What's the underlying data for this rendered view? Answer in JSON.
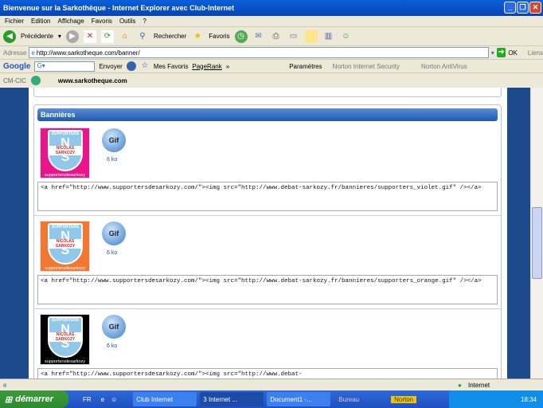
{
  "window": {
    "title": "Bienvenue sur la Sarkothèque - Internet Explorer avec Club-Internet"
  },
  "menu": [
    "Fichier",
    "Edition",
    "Affichage",
    "Favoris",
    "Outils",
    "?"
  ],
  "toolbar": {
    "back": "Précédente",
    "search": "Rechercher",
    "favorites": "Favoris"
  },
  "address": {
    "label": "Adresse",
    "url": "http://www.sarkotheque.com/banner/",
    "go": "OK",
    "links": "Liens"
  },
  "google_bar": {
    "logo": "Google",
    "send": "Envoyer",
    "favorites": "Mes Favoris",
    "pagerank": "PageRank",
    "settings": "Paramètres",
    "nis": "Norton Internet Security",
    "nav": "Norton AntiVirus"
  },
  "cic_bar": {
    "label": "CM-CIC",
    "site": "www.sarkotheque.com"
  },
  "page": {
    "section_title": "Bannières",
    "items": [
      {
        "color": "#e8158c",
        "caption": "supportersdesarkozy",
        "name": "NICOLAS SARKOZY",
        "top": "SUPPORTERS",
        "size": "6 ko",
        "code": "<a href=\"http://www.supportersdesarkozy.com/\"><img src=\"http://www.debat-sarkozy.fr/bannieres/supporters_violet.gif\" /></a>"
      },
      {
        "color": "#f07830",
        "caption": "supportersdesarkozy",
        "name": "NICOLAS SARKOZY",
        "top": "SUPPORTERS",
        "size": "6 ko",
        "code": "<a href=\"http://www.supportersdesarkozy.com/\"><img src=\"http://www.debat-sarkozy.fr/bannieres/supporters_orange.gif\" /></a>"
      },
      {
        "color": "#000000",
        "caption": "supportersdesarkozy",
        "name": "NICOLAS SARKOZY",
        "top": "SUPPORTERS",
        "size": "6 ko",
        "code": "<a href=\"http://www.supportersdesarkozy.com/\"><img src=\"http://www.debat-"
      }
    ],
    "gif_label": "Gif"
  },
  "status": {
    "zone": "Internet"
  },
  "taskbar": {
    "start": "démarrer",
    "lang": "FR",
    "tasks": [
      "Club Internet",
      "3 Internet ...",
      "Document1 -..."
    ],
    "desktop": "Bureau",
    "norton": "Norton",
    "clock": "18:34"
  }
}
